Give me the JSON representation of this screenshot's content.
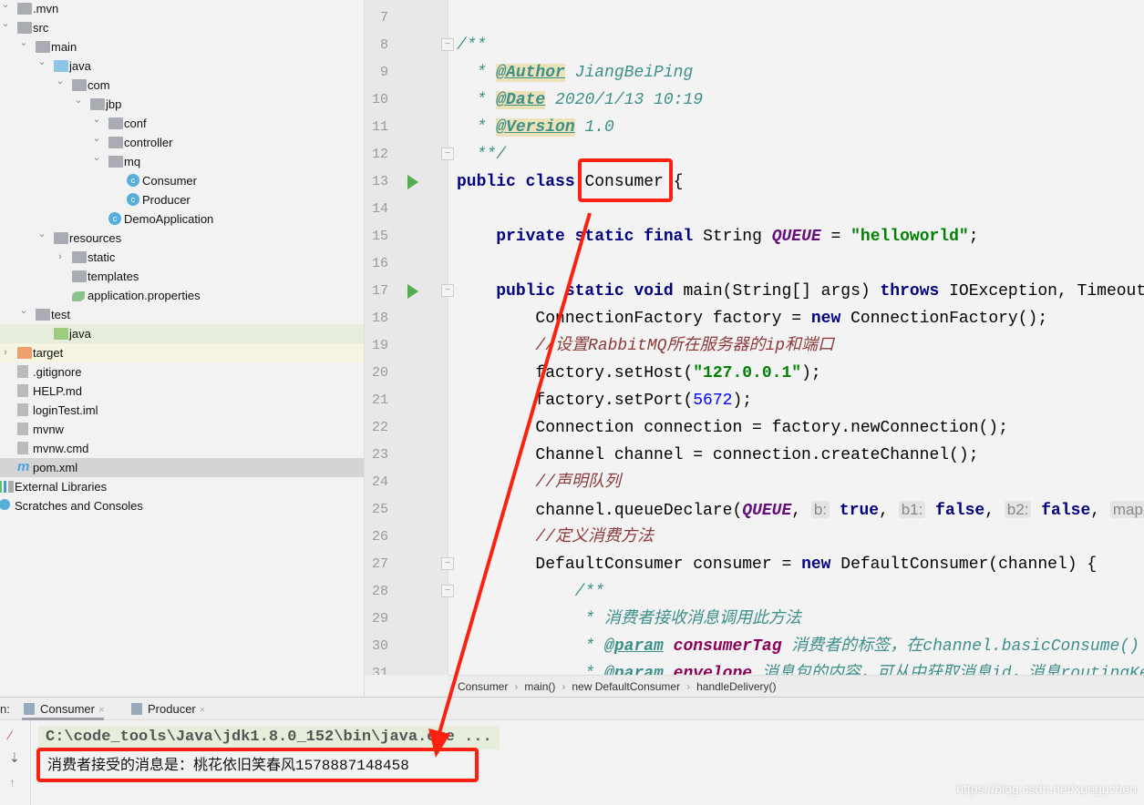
{
  "project_tree": [
    {
      "label": ".mvn",
      "depth": 0,
      "icon": "folder-icon",
      "arrow": "expanded"
    },
    {
      "label": "src",
      "depth": 0,
      "icon": "folder-icon",
      "arrow": "expanded"
    },
    {
      "label": "main",
      "depth": 1,
      "icon": "folder-icon",
      "arrow": "expanded"
    },
    {
      "label": "java",
      "depth": 2,
      "icon": "source-folder-icon",
      "arrow": "expanded"
    },
    {
      "label": "com",
      "depth": 3,
      "icon": "package-icon",
      "arrow": "expanded"
    },
    {
      "label": "jbp",
      "depth": 4,
      "icon": "package-icon",
      "arrow": "expanded"
    },
    {
      "label": "conf",
      "depth": 5,
      "icon": "package-icon",
      "arrow": "expanded"
    },
    {
      "label": "controller",
      "depth": 5,
      "icon": "package-icon",
      "arrow": "expanded"
    },
    {
      "label": "mq",
      "depth": 5,
      "icon": "package-icon",
      "arrow": "expanded"
    },
    {
      "label": "Consumer",
      "depth": 6,
      "icon": "java-class-icon",
      "arrow": ""
    },
    {
      "label": "Producer",
      "depth": 6,
      "icon": "java-class-icon",
      "arrow": ""
    },
    {
      "label": "DemoApplication",
      "depth": 5,
      "icon": "spring-boot-class-icon",
      "arrow": ""
    },
    {
      "label": "resources",
      "depth": 2,
      "icon": "resources-folder-icon",
      "arrow": "expanded"
    },
    {
      "label": "static",
      "depth": 3,
      "icon": "folder-icon",
      "arrow": "collapsed"
    },
    {
      "label": "templates",
      "depth": 3,
      "icon": "folder-icon",
      "arrow": ""
    },
    {
      "label": "application.properties",
      "depth": 3,
      "icon": "properties-file-icon",
      "arrow": ""
    },
    {
      "label": "test",
      "depth": 1,
      "icon": "folder-icon",
      "arrow": "expanded"
    },
    {
      "label": "java",
      "depth": 2,
      "icon": "test-folder-icon",
      "arrow": "",
      "highlight": "green"
    },
    {
      "label": "target",
      "depth": 0,
      "icon": "excluded-folder-icon",
      "arrow": "collapsed",
      "highlight": "yellow"
    },
    {
      "label": ".gitignore",
      "depth": 0,
      "icon": "gitignore-file-icon",
      "arrow": ""
    },
    {
      "label": "HELP.md",
      "depth": 0,
      "icon": "markdown-file-icon",
      "arrow": ""
    },
    {
      "label": "loginTest.iml",
      "depth": 0,
      "icon": "iml-file-icon",
      "arrow": ""
    },
    {
      "label": "mvnw",
      "depth": 0,
      "icon": "shell-file-icon",
      "arrow": ""
    },
    {
      "label": "mvnw.cmd",
      "depth": 0,
      "icon": "text-file-icon",
      "arrow": ""
    },
    {
      "label": "pom.xml",
      "depth": 0,
      "icon": "maven-icon",
      "arrow": "",
      "highlight": "selected"
    },
    {
      "label": "External Libraries",
      "depth": -1,
      "icon": "libraries-icon",
      "arrow": ""
    },
    {
      "label": "Scratches and Consoles",
      "depth": -1,
      "icon": "scratches-icon",
      "arrow": ""
    }
  ],
  "editor": {
    "lines": [
      {
        "n": "7",
        "t": []
      },
      {
        "n": "8",
        "fold": true,
        "t": [
          [
            "doc",
            "/**"
          ]
        ]
      },
      {
        "n": "9",
        "t": [
          [
            "doc",
            "  * "
          ],
          [
            "tag",
            "@Author"
          ],
          [
            "doc",
            " JiangBeiPing"
          ]
        ]
      },
      {
        "n": "10",
        "t": [
          [
            "doc",
            "  * "
          ],
          [
            "tag",
            "@Date"
          ],
          [
            "doc",
            " 2020/1/13 10:19"
          ]
        ]
      },
      {
        "n": "11",
        "t": [
          [
            "doc",
            "  * "
          ],
          [
            "tag",
            "@Version"
          ],
          [
            "doc",
            " 1.0"
          ]
        ]
      },
      {
        "n": "12",
        "fold": true,
        "t": [
          [
            "doc",
            "  **/"
          ]
        ]
      },
      {
        "n": "13",
        "run": true,
        "t": [
          [
            "kw",
            "public class "
          ],
          [
            "",
            "Consumer {"
          ]
        ]
      },
      {
        "n": "14",
        "t": []
      },
      {
        "n": "15",
        "t": [
          [
            "",
            "    "
          ],
          [
            "kw",
            "private static final "
          ],
          [
            "",
            "String "
          ],
          [
            "fld",
            "QUEUE"
          ],
          [
            "",
            " = "
          ],
          [
            "str",
            "\"helloworld\""
          ],
          [
            "",
            ";"
          ]
        ]
      },
      {
        "n": "16",
        "t": []
      },
      {
        "n": "17",
        "run": true,
        "fold": true,
        "t": [
          [
            "",
            "    "
          ],
          [
            "kw",
            "public static void "
          ],
          [
            "",
            "main(String[] args) "
          ],
          [
            "kw",
            "throws "
          ],
          [
            "",
            "IOException, TimeoutException {"
          ]
        ]
      },
      {
        "n": "18",
        "t": [
          [
            "",
            "        ConnectionFactory factory = "
          ],
          [
            "kw",
            "new "
          ],
          [
            "",
            "ConnectionFactory();"
          ]
        ]
      },
      {
        "n": "19",
        "t": [
          [
            "",
            "        "
          ],
          [
            "cm",
            "//设置RabbitMQ所在服务器的ip和端口"
          ]
        ]
      },
      {
        "n": "20",
        "t": [
          [
            "",
            "        factory.setHost("
          ],
          [
            "str",
            "\"127.0.0.1\""
          ],
          [
            "",
            ");"
          ]
        ]
      },
      {
        "n": "21",
        "t": [
          [
            "",
            "        factory.setPort("
          ],
          [
            "num",
            "5672"
          ],
          [
            "",
            ");"
          ]
        ]
      },
      {
        "n": "22",
        "t": [
          [
            "",
            "        Connection connection = factory.newConnection();"
          ]
        ]
      },
      {
        "n": "23",
        "t": [
          [
            "",
            "        Channel channel = connection.createChannel();"
          ]
        ]
      },
      {
        "n": "24",
        "t": [
          [
            "",
            "        "
          ],
          [
            "cm",
            "//声明队列"
          ]
        ]
      },
      {
        "n": "25",
        "t": [
          [
            "",
            "        channel.queueDeclare("
          ],
          [
            "fld",
            "QUEUE"
          ],
          [
            "",
            ", "
          ],
          [
            "hint",
            "b:"
          ],
          [
            "kw",
            "true"
          ],
          [
            "",
            ", "
          ],
          [
            "hint",
            "b1:"
          ],
          [
            "kw",
            "false"
          ],
          [
            "",
            ", "
          ],
          [
            "hint",
            "b2:"
          ],
          [
            "kw",
            "false"
          ],
          [
            "",
            ", "
          ],
          [
            "hint",
            "map:"
          ]
        ]
      },
      {
        "n": "26",
        "t": [
          [
            "",
            "        "
          ],
          [
            "cm",
            "//定义消费方法"
          ]
        ]
      },
      {
        "n": "27",
        "fold": true,
        "t": [
          [
            "",
            "        DefaultConsumer consumer = "
          ],
          [
            "kw",
            "new "
          ],
          [
            "",
            "DefaultConsumer(channel) {"
          ]
        ]
      },
      {
        "n": "28",
        "fold": true,
        "t": [
          [
            "",
            "            "
          ],
          [
            "doc",
            "/**"
          ]
        ]
      },
      {
        "n": "29",
        "t": [
          [
            "",
            "             "
          ],
          [
            "doc",
            "* 消费者接收消息调用此方法"
          ]
        ]
      },
      {
        "n": "30",
        "t": [
          [
            "",
            "             "
          ],
          [
            "doc",
            "* "
          ],
          [
            "tag2",
            "@param"
          ],
          [
            "doc",
            " "
          ],
          [
            "prm",
            "consumerTag"
          ],
          [
            "doc",
            " 消费者的标签，在channel.basicConsume()"
          ]
        ]
      },
      {
        "n": "31",
        "t": [
          [
            "",
            "             "
          ],
          [
            "doc",
            "* "
          ],
          [
            "tag2",
            "@param"
          ],
          [
            "doc",
            " "
          ],
          [
            "prm",
            "envelope"
          ],
          [
            "doc",
            " 消息包的内容，可从中获取消息id，消息routingKey"
          ]
        ]
      }
    ]
  },
  "breadcrumb": [
    "Consumer",
    "main()",
    "new DefaultConsumer",
    "handleDelivery()"
  ],
  "run_panel": {
    "label": "n:",
    "tabs": [
      {
        "label": "Consumer",
        "active": true
      },
      {
        "label": "Producer",
        "active": false
      }
    ],
    "close_glyph": "×",
    "command": "C:\\code_tools\\Java\\jdk1.8.0_152\\bin\\java.exe ...",
    "output": "消费者接受的消息是：桃花依旧笑春风1578887148458"
  },
  "watermark": "https://blog.csdn.net/xueguchen",
  "colors": {
    "annotation_red": "#ff2010",
    "keyword": "#000080",
    "string": "#008000",
    "run_icon": "#4caf50"
  }
}
